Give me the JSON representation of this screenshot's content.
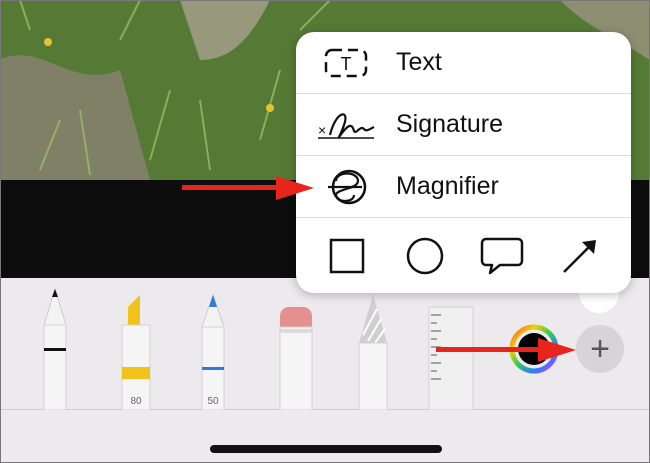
{
  "menu": {
    "items": [
      {
        "label": "Text",
        "icon": "text-box-icon"
      },
      {
        "label": "Signature",
        "icon": "signature-icon"
      },
      {
        "label": "Magnifier",
        "icon": "magnifier-icon"
      }
    ],
    "shapes": [
      "square-icon",
      "circle-icon",
      "speech-bubble-icon",
      "arrow-icon"
    ]
  },
  "toolbar": {
    "tools": [
      {
        "name": "pen"
      },
      {
        "name": "marker",
        "size": "80"
      },
      {
        "name": "pencil",
        "size": "50"
      },
      {
        "name": "eraser"
      },
      {
        "name": "lasso"
      },
      {
        "name": "ruler"
      }
    ],
    "plus_label": "+"
  },
  "colors": {
    "arrow": "#e8251a",
    "marker": "#f2c21b",
    "pencil": "#2e7bdc",
    "eraser": "#e68f8f"
  }
}
